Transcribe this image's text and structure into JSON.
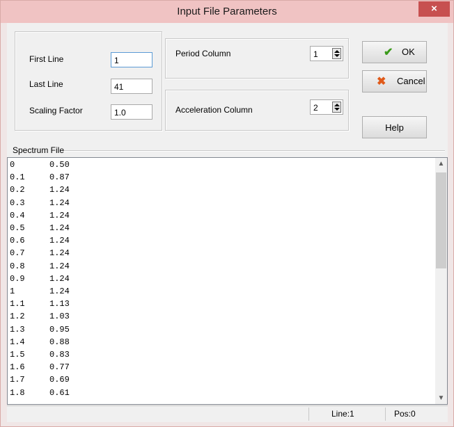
{
  "window": {
    "title": "Input File Parameters",
    "close_glyph": "×"
  },
  "params": {
    "first_line_label": "First Line",
    "first_line_value": "1",
    "last_line_label": "Last Line",
    "last_line_value": "41",
    "scaling_label": "Scaling Factor",
    "scaling_value": "1.0"
  },
  "columns": {
    "period_label": "Period Column",
    "period_value": "1",
    "accel_label": "Acceleration Column",
    "accel_value": "2"
  },
  "buttons": {
    "ok_label": "OK",
    "cancel_label": "Cancel",
    "help_label": "Help",
    "ok_icon": "checkmark-icon",
    "cancel_icon": "x-icon",
    "ok_color": "#3a9a1a",
    "cancel_color": "#e05a1a"
  },
  "spectrum": {
    "label": "Spectrum File",
    "rows": [
      {
        "a": "0",
        "b": "0.50"
      },
      {
        "a": "0.1",
        "b": "0.87"
      },
      {
        "a": "0.2",
        "b": "1.24"
      },
      {
        "a": "0.3",
        "b": "1.24"
      },
      {
        "a": "0.4",
        "b": "1.24"
      },
      {
        "a": "0.5",
        "b": "1.24"
      },
      {
        "a": "0.6",
        "b": "1.24"
      },
      {
        "a": "0.7",
        "b": "1.24"
      },
      {
        "a": "0.8",
        "b": "1.24"
      },
      {
        "a": "0.9",
        "b": "1.24"
      },
      {
        "a": "1",
        "b": "1.24"
      },
      {
        "a": "1.1",
        "b": "1.13"
      },
      {
        "a": "1.2",
        "b": "1.03"
      },
      {
        "a": "1.3",
        "b": "0.95"
      },
      {
        "a": "1.4",
        "b": "0.88"
      },
      {
        "a": "1.5",
        "b": "0.83"
      },
      {
        "a": "1.6",
        "b": "0.77"
      },
      {
        "a": "1.7",
        "b": "0.69"
      },
      {
        "a": "1.8",
        "b": "0.61"
      }
    ]
  },
  "status": {
    "line": "Line:1",
    "pos": "Pos:0"
  }
}
